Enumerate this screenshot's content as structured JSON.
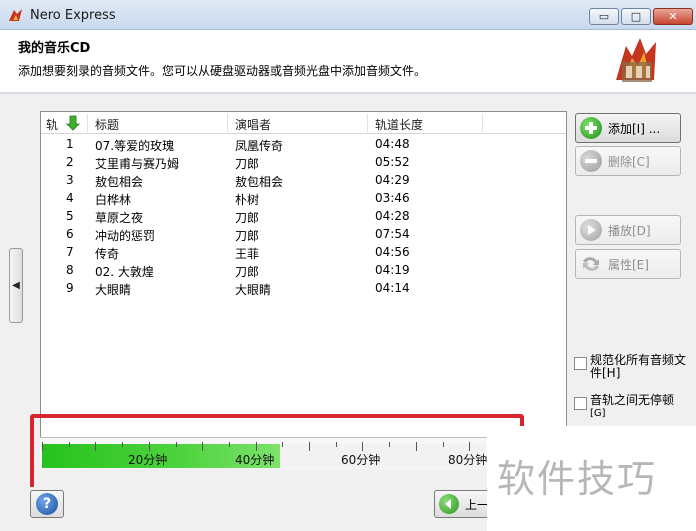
{
  "window": {
    "title": "Nero Express",
    "buttons": {
      "minimize": "▭",
      "maximize": "□",
      "close": "✕"
    }
  },
  "header": {
    "title": "我的音乐CD",
    "description": "添加想要刻录的音频文件。您可以从硬盘驱动器或音频光盘中添加音频文件。"
  },
  "list": {
    "columns": {
      "number": "轨",
      "title": "标题",
      "artist": "演唱者",
      "length": "轨道长度"
    },
    "tracks": [
      {
        "no": "1",
        "title": "07.等爱的玫瑰",
        "artist": "凤凰传奇",
        "length": "04:48"
      },
      {
        "no": "2",
        "title": "艾里甫与赛乃姆",
        "artist": "刀郎",
        "length": "05:52"
      },
      {
        "no": "3",
        "title": "敖包相会",
        "artist": "敖包相会",
        "length": "04:29"
      },
      {
        "no": "4",
        "title": "白桦林",
        "artist": "朴树",
        "length": "03:46"
      },
      {
        "no": "5",
        "title": "草原之夜",
        "artist": "刀郎",
        "length": "04:28"
      },
      {
        "no": "6",
        "title": "冲动的惩罚",
        "artist": "刀郎",
        "length": "07:54"
      },
      {
        "no": "7",
        "title": "传奇",
        "artist": "王菲",
        "length": "04:56"
      },
      {
        "no": "8",
        "title": "02. 大敦煌",
        "artist": "刀郎",
        "length": "04:19"
      },
      {
        "no": "9",
        "title": "大眼睛",
        "artist": "大眼睛",
        "length": "04:14"
      }
    ]
  },
  "side_buttons": {
    "add": "添加[I] ...",
    "delete": "删除[C]",
    "play": "播放[D]",
    "properties": "属性[E]"
  },
  "options": {
    "normalize": "规范化所有音频文件[H]",
    "no_pause": "音轨之间无停顿",
    "no_pause_key": "[G]"
  },
  "capacity": {
    "labels": [
      "20分钟",
      "40分钟",
      "60分钟",
      "80分钟"
    ],
    "used_fraction": 0.537,
    "color": "#2ec126"
  },
  "footer": {
    "help": "?",
    "back": "上一"
  },
  "watermark": "软件技巧",
  "colors": {
    "highlight": "#d8242c",
    "accent": "#2ec126"
  }
}
